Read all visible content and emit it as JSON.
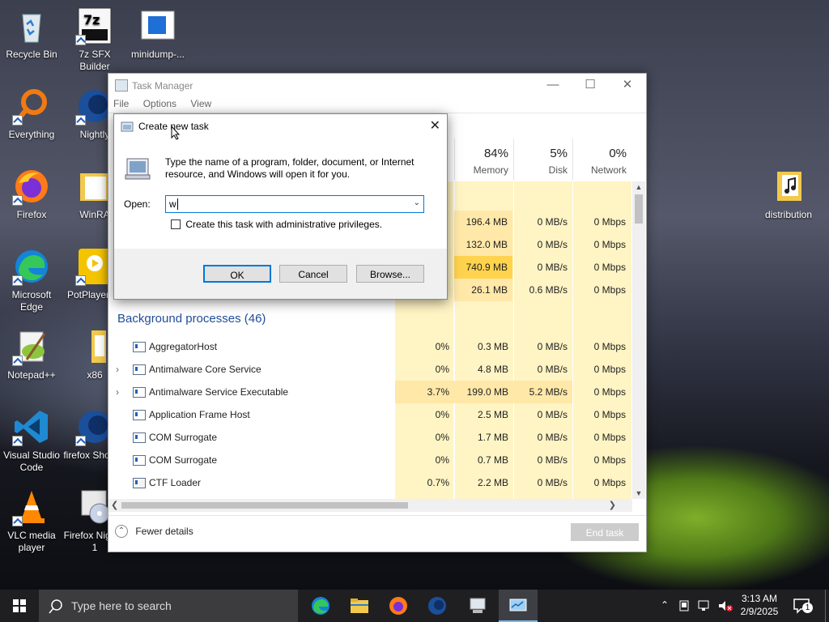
{
  "desktop": {
    "icons": [
      {
        "label": "Recycle Bin"
      },
      {
        "label": "7z SFX Builder"
      },
      {
        "label": "minidump-..."
      },
      {
        "label": "Everything"
      },
      {
        "label": "Nightly"
      },
      {
        "label": "Firefox"
      },
      {
        "label": "WinRA"
      },
      {
        "label": "Microsoft Edge"
      },
      {
        "label": "PotPlayer bit"
      },
      {
        "label": "Notepad++"
      },
      {
        "label": "x86"
      },
      {
        "label": "Visual Studio Code"
      },
      {
        "label": "firefox Shortcu"
      },
      {
        "label": "VLC media player"
      },
      {
        "label": "Firefox Nightly 1"
      },
      {
        "label": "distribution"
      }
    ]
  },
  "task_manager": {
    "title": "Task Manager",
    "menu": [
      "File",
      "Options",
      "View"
    ],
    "columns": [
      {
        "pct": "84%",
        "label": "Memory"
      },
      {
        "pct": "5%",
        "label": "Disk"
      },
      {
        "pct": "0%",
        "label": "Network"
      }
    ],
    "apps_rows": [
      {
        "memory": "196.4 MB",
        "disk": "0 MB/s",
        "network": "0 Mbps"
      },
      {
        "memory": "132.0 MB",
        "disk": "0 MB/s",
        "network": "0 Mbps"
      },
      {
        "memory": "740.9 MB",
        "disk": "0 MB/s",
        "network": "0 Mbps"
      },
      {
        "memory": "26.1 MB",
        "disk": "0.6 MB/s",
        "network": "0 Mbps"
      }
    ],
    "background_header": "Background processes (46)",
    "background_rows": [
      {
        "name": "AggregatorHost",
        "cpu": "0%",
        "memory": "0.3 MB",
        "disk": "0 MB/s",
        "network": "0 Mbps",
        "expand": false
      },
      {
        "name": "Antimalware Core Service",
        "cpu": "0%",
        "memory": "4.8 MB",
        "disk": "0 MB/s",
        "network": "0 Mbps",
        "expand": true
      },
      {
        "name": "Antimalware Service Executable",
        "cpu": "3.7%",
        "memory": "199.0 MB",
        "disk": "5.2 MB/s",
        "network": "0 Mbps",
        "expand": true
      },
      {
        "name": "Application Frame Host",
        "cpu": "0%",
        "memory": "2.5 MB",
        "disk": "0 MB/s",
        "network": "0 Mbps",
        "expand": false
      },
      {
        "name": "COM Surrogate",
        "cpu": "0%",
        "memory": "1.7 MB",
        "disk": "0 MB/s",
        "network": "0 Mbps",
        "expand": false
      },
      {
        "name": "COM Surrogate",
        "cpu": "0%",
        "memory": "0.7 MB",
        "disk": "0 MB/s",
        "network": "0 Mbps",
        "expand": false
      },
      {
        "name": "CTF Loader",
        "cpu": "0.7%",
        "memory": "2.2 MB",
        "disk": "0 MB/s",
        "network": "0 Mbps",
        "expand": false
      }
    ],
    "fewer_details": "Fewer details",
    "end_task": "End task"
  },
  "run_dialog": {
    "title": "Create new task",
    "description": "Type the name of a program, folder, document, or Internet resource, and Windows will open it for you.",
    "open_label": "Open:",
    "open_value": "w",
    "admin_checkbox_label": "Create this task with administrative privileges.",
    "admin_checked": false,
    "ok": "OK",
    "cancel": "Cancel",
    "browse": "Browse..."
  },
  "taskbar": {
    "search_placeholder": "Type here to search",
    "time": "3:13 AM",
    "date": "2/9/2025",
    "notification_count": "1"
  }
}
